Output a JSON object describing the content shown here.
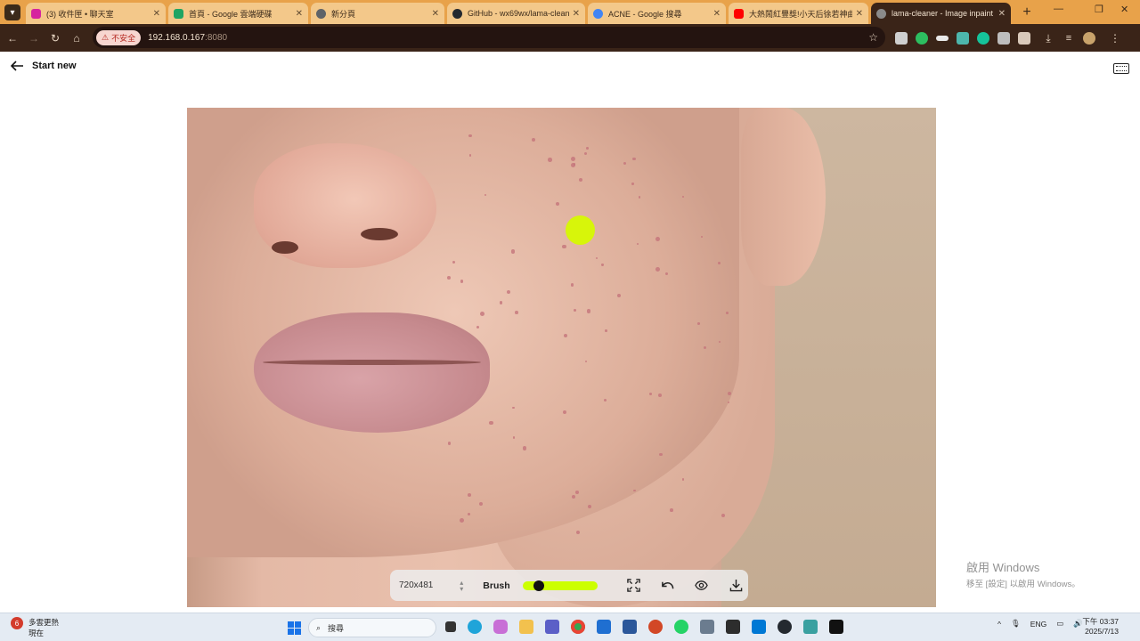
{
  "browser": {
    "tabs": [
      {
        "label": "(3) 收件匣 • 聊天室",
        "color": "#d6249f"
      },
      {
        "label": "首頁 - Google 雲端硬碟",
        "color": "#1fa463"
      },
      {
        "label": "新分頁",
        "color": "#5f6368"
      },
      {
        "label": "GitHub - wx69wx/lama-clean",
        "color": "#24292f"
      },
      {
        "label": "ACNE - Google 搜尋",
        "color": "#4285f4"
      },
      {
        "label": "大熱鬧紅豐獎!小天后徐若神曲",
        "color": "#ff0000"
      },
      {
        "label": "lama-cleaner - Image inpaint",
        "color": "#8a8a8a"
      }
    ],
    "new_tab_label": "+",
    "insecure_label": "不安全",
    "url_host": "192.168.0.167",
    "url_port": ":8080"
  },
  "app": {
    "start_new_label": "Start new"
  },
  "editor": {
    "image_size": "720x481",
    "brush_label": "Brush",
    "brush_size_fraction": 0.17,
    "brush_color": "#ccff00"
  },
  "watermark": {
    "line1": "啟用 Windows",
    "line2": "移至 [設定] 以啟用 Windows。"
  },
  "taskbar": {
    "weather_line1": "多雲更熱",
    "weather_line2": "現在",
    "weather_badge": "6",
    "search_placeholder": "搜尋",
    "ime_label": "ENG",
    "clock_time": "下午 03:37",
    "clock_date": "2025/7/13"
  }
}
